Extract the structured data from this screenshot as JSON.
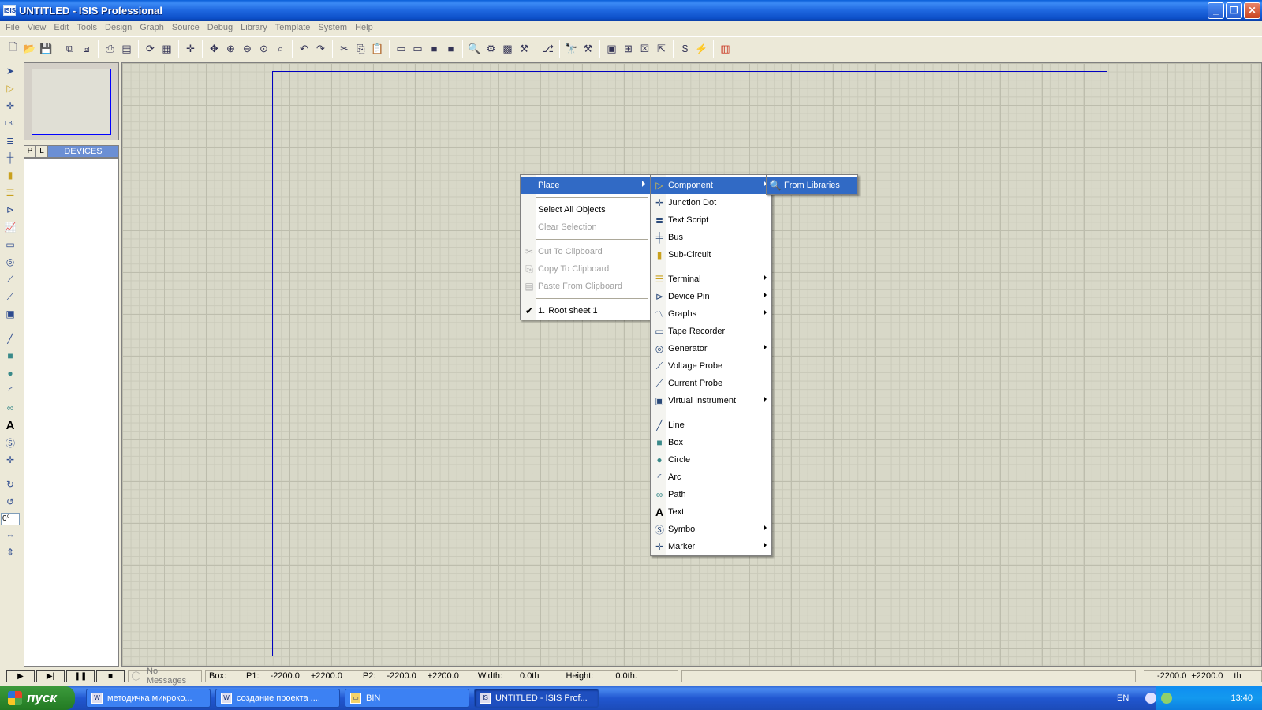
{
  "window": {
    "title": "UNTITLED - ISIS Professional",
    "icon_text": "ISIS"
  },
  "menubar": [
    "File",
    "View",
    "Edit",
    "Tools",
    "Design",
    "Graph",
    "Source",
    "Debug",
    "Library",
    "Template",
    "System",
    "Help"
  ],
  "device_panel": {
    "p_button": "P",
    "l_button": "L",
    "header": "DEVICES"
  },
  "rotation_value": "0°",
  "context_menu": {
    "place": "Place",
    "select_all": "Select All Objects",
    "clear_selection": "Clear Selection",
    "cut": "Cut To Clipboard",
    "copy": "Copy To Clipboard",
    "paste": "Paste From Clipboard",
    "root_sheet_num": "1.",
    "root_sheet": "Root sheet 1"
  },
  "place_menu": {
    "component": "Component",
    "junction_dot": "Junction Dot",
    "text_script": "Text Script",
    "bus": "Bus",
    "sub_circuit": "Sub-Circuit",
    "terminal": "Terminal",
    "device_pin": "Device Pin",
    "graphs": "Graphs",
    "tape_recorder": "Tape Recorder",
    "generator": "Generator",
    "voltage_probe": "Voltage Probe",
    "current_probe": "Current Probe",
    "virtual_instrument": "Virtual Instrument",
    "line": "Line",
    "box": "Box",
    "circle": "Circle",
    "arc": "Arc",
    "path": "Path",
    "text": "Text",
    "symbol": "Symbol",
    "marker": "Marker"
  },
  "component_menu": {
    "from_libraries": "From Libraries"
  },
  "statusbar": {
    "messages": "No Messages",
    "box_label": "Box:",
    "p1_label": "P1:",
    "p1_x": "-2200.0",
    "p1_y": "+2200.0",
    "p2_label": "P2:",
    "p2_x": "-2200.0",
    "p2_y": "+2200.0",
    "width_label": "Width:",
    "width_value": "0.0th",
    "height_label": "Height:",
    "height_value": "0.0th.",
    "coord_x": "-2200.0",
    "coord_y": "+2200.0",
    "units": "th"
  },
  "taskbar": {
    "start": "пуск",
    "tasks": [
      "методичка микроко...",
      "создание проекта ....",
      "BIN",
      "UNTITLED - ISIS Prof..."
    ],
    "lang": "EN",
    "clock": "13:40"
  },
  "colors": {
    "canvas_bg": "#d8d8c8",
    "sheet_border": "#0000c0",
    "highlight": "#316ac5"
  }
}
